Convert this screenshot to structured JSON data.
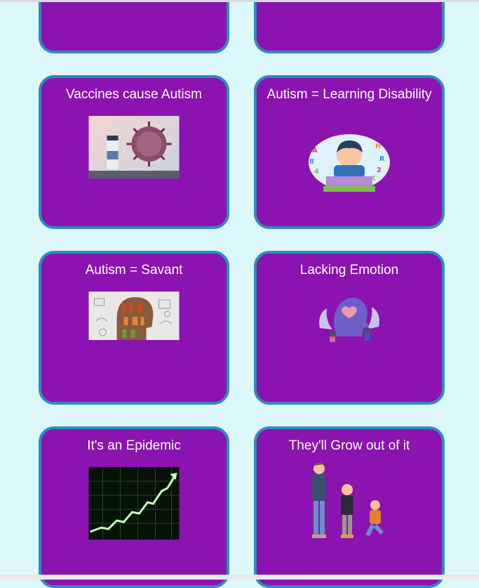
{
  "cards": [
    {
      "title": ""
    },
    {
      "title": ""
    },
    {
      "title": "Vaccines cause Autism",
      "icon": "vaccine-virus-image"
    },
    {
      "title": "Autism = Learning Disability",
      "icon": "confused-child-image"
    },
    {
      "title": "Autism = Savant",
      "icon": "brain-bookshelf-image"
    },
    {
      "title": "Lacking Emotion",
      "icon": "heart-head-image"
    },
    {
      "title": "It's an Epidemic",
      "icon": "rising-graph-image"
    },
    {
      "title": "They'll Grow out of it",
      "icon": "growing-children-image"
    }
  ],
  "colors": {
    "background": "#ddf8fa",
    "card": "#8b13b0",
    "card_border": "#2f8bbd",
    "text": "#ffffff"
  }
}
